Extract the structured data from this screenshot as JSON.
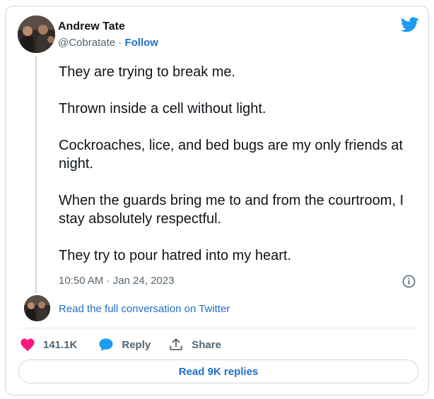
{
  "author": {
    "name": "Andrew Tate",
    "handle": "@Cobratate",
    "separator": "·",
    "follow_label": "Follow"
  },
  "tweet": {
    "paragraphs": [
      "They are trying to break me.",
      "Thrown inside a cell without light.",
      "Cockroaches, lice, and bed bugs are my only friends at night.",
      "When the guards bring me to and from the courtroom, I stay absolutely respectful.",
      "They try to pour hatred into my heart."
    ],
    "timestamp": "10:50 AM · Jan 24, 2023"
  },
  "conversation": {
    "read_full_label": "Read the full conversation on Twitter"
  },
  "actions": {
    "like_count": "141.1K",
    "reply_label": "Reply",
    "share_label": "Share"
  },
  "replies_button_label": "Read 9K replies",
  "icons": {
    "brand": "twitter-bird-icon",
    "info": "info-icon",
    "like": "heart-icon",
    "reply": "speech-bubble-icon",
    "share": "share-upload-icon"
  },
  "colors": {
    "twitter_blue": "#1d9bf0",
    "link_blue": "#1f6fc5",
    "heart_pink": "#f91880",
    "text_primary": "#0f1419",
    "text_secondary": "#536471",
    "border": "#cfd9de"
  }
}
